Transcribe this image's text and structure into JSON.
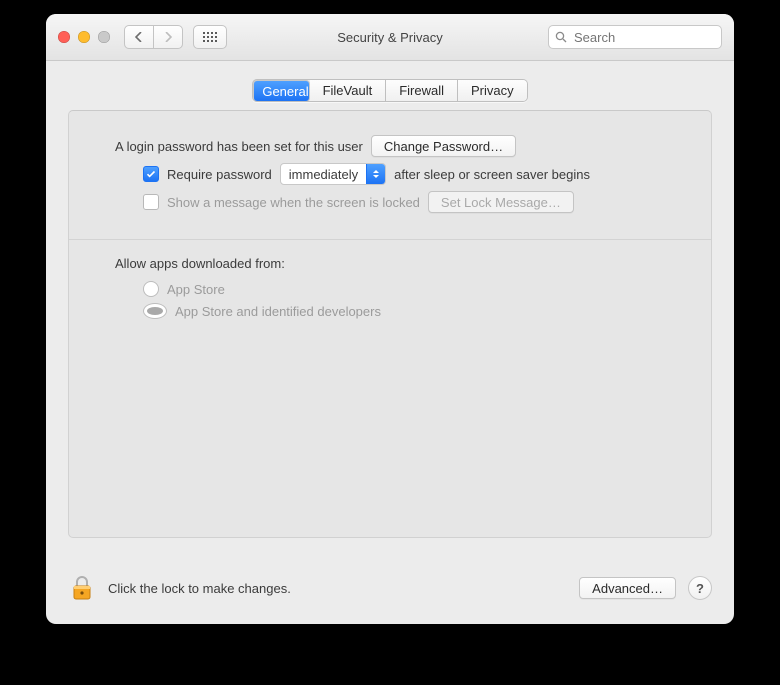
{
  "window": {
    "title": "Security & Privacy"
  },
  "toolbar": {
    "search_placeholder": "Search"
  },
  "tabs": {
    "general": "General",
    "filevault": "FileVault",
    "firewall": "Firewall",
    "privacy": "Privacy"
  },
  "general": {
    "login_set": "A login password has been set for this user",
    "change_password": "Change Password…",
    "require_password": "Require password",
    "delay_value": "immediately",
    "after_sleep": "after sleep or screen saver begins",
    "show_message": "Show a message when the screen is locked",
    "set_lock_message": "Set Lock Message…",
    "allow_label": "Allow apps downloaded from:",
    "radio_appstore": "App Store",
    "radio_identified": "App Store and identified developers"
  },
  "footer": {
    "lock_hint": "Click the lock to make changes.",
    "advanced": "Advanced…",
    "help": "?"
  }
}
